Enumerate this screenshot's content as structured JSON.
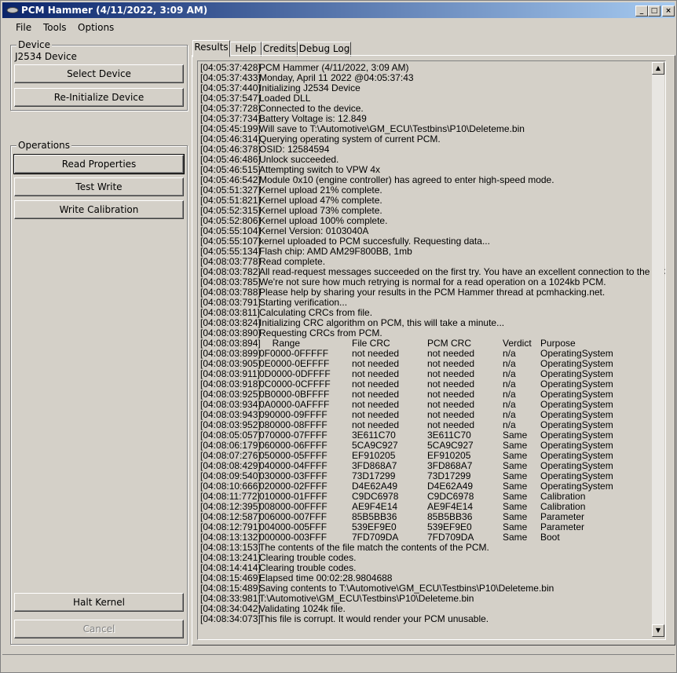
{
  "window": {
    "title": "PCM Hammer (4/11/2022, 3:09 AM)"
  },
  "menu": [
    "File",
    "Tools",
    "Options"
  ],
  "device_group": {
    "label": "Device",
    "device_name": "J2534 Device",
    "select_button": "Select Device",
    "reinit_button": "Re-Initialize Device"
  },
  "operations_group": {
    "label": "Operations",
    "read_button": "Read Properties",
    "test_button": "Test Write",
    "write_button": "Write Calibration",
    "halt_button": "Halt Kernel",
    "cancel_button": "Cancel"
  },
  "tabs": [
    "Results",
    "Help",
    "Credits",
    "Debug Log"
  ],
  "log_lines": [
    {
      "t": "[04:05:37:428]",
      "m": "PCM Hammer (4/11/2022, 3:09 AM)"
    },
    {
      "t": "[04:05:37:433]",
      "m": "Monday, April 11 2022 @04:05:37:43"
    },
    {
      "t": "[04:05:37:440]",
      "m": "Initializing J2534 Device"
    },
    {
      "t": "[04:05:37:547]",
      "m": "Loaded DLL"
    },
    {
      "t": "[04:05:37:728]",
      "m": "Connected to the device."
    },
    {
      "t": "[04:05:37:734]",
      "m": "Battery Voltage is: 12.849"
    },
    {
      "t": "[04:05:45:199]",
      "m": "Will save to T:\\Automotive\\GM_ECU\\Testbins\\P10\\Deleteme.bin"
    },
    {
      "t": "[04:05:46:314]",
      "m": "Querying operating system of current PCM."
    },
    {
      "t": "[04:05:46:378]",
      "m": "OSID: 12584594"
    },
    {
      "t": "[04:05:46:486]",
      "m": "Unlock succeeded."
    },
    {
      "t": "[04:05:46:515]",
      "m": "Attempting switch to VPW 4x"
    },
    {
      "t": "[04:05:46:542]",
      "m": "Module 0x10 (engine controller) has agreed to enter high-speed mode."
    },
    {
      "t": "[04:05:51:327]",
      "m": "Kernel upload 21% complete."
    },
    {
      "t": "[04:05:51:821]",
      "m": "Kernel upload 47% complete."
    },
    {
      "t": "[04:05:52:315]",
      "m": "Kernel upload 73% complete."
    },
    {
      "t": "[04:05:52:806]",
      "m": "Kernel upload 100% complete."
    },
    {
      "t": "[04:05:55:104]",
      "m": "Kernel Version: 0103040A"
    },
    {
      "t": "[04:05:55:107]",
      "m": "kernel uploaded to PCM succesfully. Requesting data..."
    },
    {
      "t": "[04:05:55:134]",
      "m": "Flash chip: AMD AM29F800BB, 1mb"
    },
    {
      "t": "[04:08:03:778]",
      "m": "Read complete."
    },
    {
      "t": "[04:08:03:782]",
      "m": "All read-request messages succeeded on the first try. You have an excellent connection to the PCM."
    },
    {
      "t": "[04:08:03:785]",
      "m": "We're not sure how much retrying is normal for a read operation on a 1024kb PCM."
    },
    {
      "t": "[04:08:03:788]",
      "m": "Please help by sharing your results in the PCM Hammer thread at pcmhacking.net."
    },
    {
      "t": "[04:08:03:791]",
      "m": "Starting verification..."
    },
    {
      "t": "[04:08:03:811]",
      "m": "Calculating CRCs from file."
    },
    {
      "t": "[04:08:03:824]",
      "m": "Initializing CRC algorithm on PCM, this will take a minute..."
    },
    {
      "t": "[04:08:03:890]",
      "m": "Requesting CRCs from PCM."
    }
  ],
  "crc_header": {
    "t": "[04:08:03:894]",
    "range": "Range",
    "file": "File CRC",
    "pcm": "PCM CRC",
    "verdict": "Verdict",
    "purpose": "Purpose"
  },
  "crc_rows": [
    {
      "t": "[04:08:03:899]",
      "range": "0F0000-0FFFFF",
      "file": "not needed",
      "pcm": "not needed",
      "verdict": "n/a",
      "purpose": "OperatingSystem"
    },
    {
      "t": "[04:08:03:905]",
      "range": "0E0000-0EFFFF",
      "file": "not needed",
      "pcm": "not needed",
      "verdict": "n/a",
      "purpose": "OperatingSystem"
    },
    {
      "t": "[04:08:03:911]",
      "range": "0D0000-0DFFFF",
      "file": "not needed",
      "pcm": "not needed",
      "verdict": "n/a",
      "purpose": "OperatingSystem"
    },
    {
      "t": "[04:08:03:918]",
      "range": "0C0000-0CFFFF",
      "file": "not needed",
      "pcm": "not needed",
      "verdict": "n/a",
      "purpose": "OperatingSystem"
    },
    {
      "t": "[04:08:03:925]",
      "range": "0B0000-0BFFFF",
      "file": "not needed",
      "pcm": "not needed",
      "verdict": "n/a",
      "purpose": "OperatingSystem"
    },
    {
      "t": "[04:08:03:934]",
      "range": "0A0000-0AFFFF",
      "file": "not needed",
      "pcm": "not needed",
      "verdict": "n/a",
      "purpose": "OperatingSystem"
    },
    {
      "t": "[04:08:03:943]",
      "range": "090000-09FFFF",
      "file": "not needed",
      "pcm": "not needed",
      "verdict": "n/a",
      "purpose": "OperatingSystem"
    },
    {
      "t": "[04:08:03:952]",
      "range": "080000-08FFFF",
      "file": "not needed",
      "pcm": "not needed",
      "verdict": "n/a",
      "purpose": "OperatingSystem"
    },
    {
      "t": "[04:08:05:057]",
      "range": "070000-07FFFF",
      "file": "3E611C70",
      "pcm": "3E611C70",
      "verdict": "Same",
      "purpose": "OperatingSystem"
    },
    {
      "t": "[04:08:06:179]",
      "range": "060000-06FFFF",
      "file": "5CA9C927",
      "pcm": "5CA9C927",
      "verdict": "Same",
      "purpose": "OperatingSystem"
    },
    {
      "t": "[04:08:07:276]",
      "range": "050000-05FFFF",
      "file": "EF910205",
      "pcm": "EF910205",
      "verdict": "Same",
      "purpose": "OperatingSystem"
    },
    {
      "t": "[04:08:08:429]",
      "range": "040000-04FFFF",
      "file": "3FD868A7",
      "pcm": "3FD868A7",
      "verdict": "Same",
      "purpose": "OperatingSystem"
    },
    {
      "t": "[04:08:09:540]",
      "range": "030000-03FFFF",
      "file": "73D17299",
      "pcm": "73D17299",
      "verdict": "Same",
      "purpose": "OperatingSystem"
    },
    {
      "t": "[04:08:10:666]",
      "range": "020000-02FFFF",
      "file": "D4E62A49",
      "pcm": "D4E62A49",
      "verdict": "Same",
      "purpose": "OperatingSystem"
    },
    {
      "t": "[04:08:11:772]",
      "range": "010000-01FFFF",
      "file": "C9DC6978",
      "pcm": "C9DC6978",
      "verdict": "Same",
      "purpose": "Calibration"
    },
    {
      "t": "[04:08:12:395]",
      "range": "008000-00FFFF",
      "file": "AE9F4E14",
      "pcm": "AE9F4E14",
      "verdict": "Same",
      "purpose": "Calibration"
    },
    {
      "t": "[04:08:12:587]",
      "range": "006000-007FFF",
      "file": "85B5BB36",
      "pcm": "85B5BB36",
      "verdict": "Same",
      "purpose": "Parameter"
    },
    {
      "t": "[04:08:12:791]",
      "range": "004000-005FFF",
      "file": "539EF9E0",
      "pcm": "539EF9E0",
      "verdict": "Same",
      "purpose": "Parameter"
    },
    {
      "t": "[04:08:13:132]",
      "range": "000000-003FFF",
      "file": "7FD709DA",
      "pcm": "7FD709DA",
      "verdict": "Same",
      "purpose": "Boot"
    }
  ],
  "log_lines_end": [
    {
      "t": "[04:08:13:153]",
      "m": "The contents of the file match the contents of the PCM."
    },
    {
      "t": "[04:08:13:241]",
      "m": "Clearing trouble codes."
    },
    {
      "t": "[04:08:14:414]",
      "m": "Clearing trouble codes."
    },
    {
      "t": "[04:08:15:469]",
      "m": "Elapsed time 00:02:28.9804688"
    },
    {
      "t": "[04:08:15:489]",
      "m": "Saving contents to T:\\Automotive\\GM_ECU\\Testbins\\P10\\Deleteme.bin"
    },
    {
      "t": "[04:08:33:981]",
      "m": "T:\\Automotive\\GM_ECU\\Testbins\\P10\\Deleteme.bin"
    },
    {
      "t": "[04:08:34:042]",
      "m": "Validating 1024k file."
    },
    {
      "t": "[04:08:34:073]",
      "m": "This file is corrupt. It would render your PCM unusable."
    }
  ]
}
